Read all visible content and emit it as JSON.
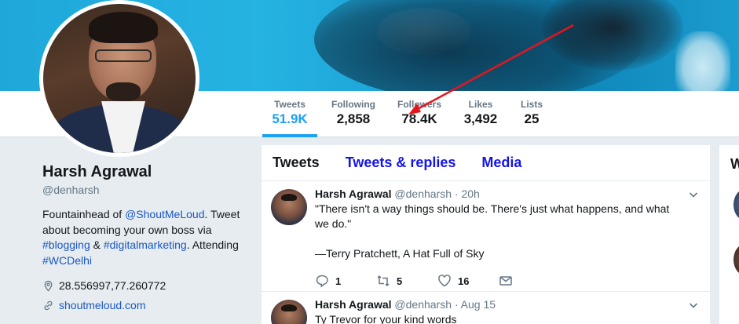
{
  "profile": {
    "name": "Harsh Agrawal",
    "handle": "@denharsh",
    "bio_part1": "Fountainhead of ",
    "bio_mention": "@ShoutMeLoud",
    "bio_part2": ". Tweet about becoming your own boss via ",
    "bio_tag1": "#blogging",
    "bio_part3": " & ",
    "bio_tag2": "#digitalmarketing",
    "bio_part4": ". Attending ",
    "bio_tag3": "#WCDelhi",
    "location": "28.556997,77.260772",
    "website": "shoutmeloud.com"
  },
  "stats": [
    {
      "label": "Tweets",
      "value": "51.9K"
    },
    {
      "label": "Following",
      "value": "2,858"
    },
    {
      "label": "Followers",
      "value": "78.4K"
    },
    {
      "label": "Likes",
      "value": "3,492"
    },
    {
      "label": "Lists",
      "value": "25"
    }
  ],
  "tabs": [
    {
      "label": "Tweets"
    },
    {
      "label": "Tweets & replies"
    },
    {
      "label": "Media"
    }
  ],
  "tweets": [
    {
      "author": "Harsh Agrawal",
      "meta": "@denharsh · 20h",
      "line1": "\"There isn't a way things should be. There's just what happens, and what we do.\"",
      "line2": "—Terry Pratchett, A Hat Full of Sky",
      "replies": "1",
      "retweets": "5",
      "likes": "16"
    },
    {
      "author": "Harsh Agrawal",
      "meta": "@denharsh · Aug 15",
      "line1": "Ty Trevor for your kind words"
    }
  ],
  "right_column": {
    "heading_fragment": "W"
  },
  "colors": {
    "accent": "#1da1f2",
    "link": "#1b57c4",
    "tab_link": "#1414e8",
    "annotation_arrow": "#e8141c"
  }
}
